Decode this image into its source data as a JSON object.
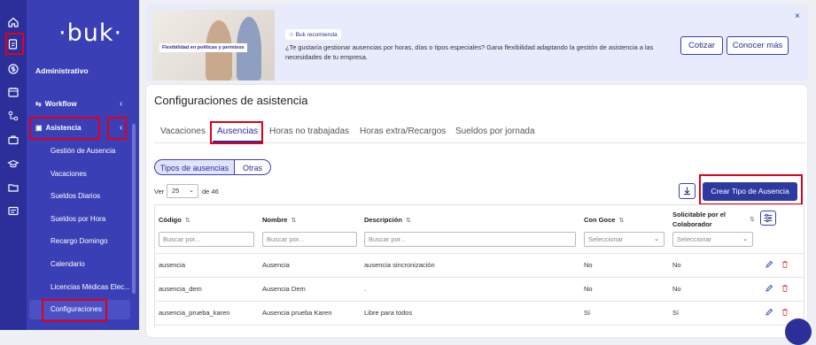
{
  "sidebar": {
    "logo": "·buk·",
    "section": "Administrativo",
    "items": [
      {
        "label": "Workflow"
      },
      {
        "label": "Asistencia"
      },
      {
        "label": "Gestión de Ausencia"
      },
      {
        "label": "Vacaciones"
      },
      {
        "label": "Sueldos Diarios"
      },
      {
        "label": "Sueldos por Hora"
      },
      {
        "label": "Recargo Domingo"
      },
      {
        "label": "Calendario"
      },
      {
        "label": "Licencias Médicas Elec..."
      },
      {
        "label": "Configuraciones"
      }
    ],
    "rail_icons": [
      "home-icon",
      "documents-icon",
      "dollar-icon",
      "calendar-icon",
      "org-icon",
      "briefcase-icon",
      "graduation-icon",
      "folder-icon",
      "id-card-icon"
    ]
  },
  "banner": {
    "image_text": "Flexibilidad en políticas y permisos",
    "tag": "Buk recomienda",
    "text": "¿Te gustaría gestionar ausencias por horas, días o tipos especiales? Gana flexibilidad adaptando la gestión de asistencia a las necesidades de tu empresa.",
    "btn_cotizar": "Cotizar",
    "btn_conocer": "Conocer más",
    "close": "×"
  },
  "page": {
    "title": "Configuraciones de asistencia",
    "tabs": [
      {
        "label": "Vacaciones"
      },
      {
        "label": "Ausencias"
      },
      {
        "label": "Horas no trabajadas"
      },
      {
        "label": "Horas extra/Recargos"
      },
      {
        "label": "Sueldos por jornada"
      }
    ],
    "segments": [
      {
        "label": "Tipos de ausencias"
      },
      {
        "label": "Otras"
      }
    ],
    "ver_label": "Ver",
    "page_size": "25",
    "of_total": "de 46",
    "create_button": "Crear Tipo de Ausencia"
  },
  "table": {
    "headers": [
      "Código",
      "Nombre",
      "Descripción",
      "Con Goce",
      "Solicitable por el Colaborador"
    ],
    "sort_glyph": "⇅",
    "placeholders": [
      "Buscar por...",
      "Buscar por...",
      "Buscar por...",
      "Seleccionar",
      "Seleccionar"
    ],
    "rows": [
      [
        "ausencia",
        "Ausencia",
        "ausencia sincronización",
        "No",
        "No"
      ],
      [
        "ausencia_dem",
        "Ausencia Dem",
        ".",
        "No",
        "No"
      ],
      [
        "ausencia_prueba_karen",
        "Ausencia prueba Karen",
        "Libre para todos",
        "Sí",
        "Sí"
      ]
    ]
  },
  "colors": {
    "sidebar": "#3a3fb5",
    "rail": "#2c2f9a",
    "accent": "#2c2f9a",
    "primary_button": "#2c3aa0",
    "highlight": "#e0001b"
  }
}
